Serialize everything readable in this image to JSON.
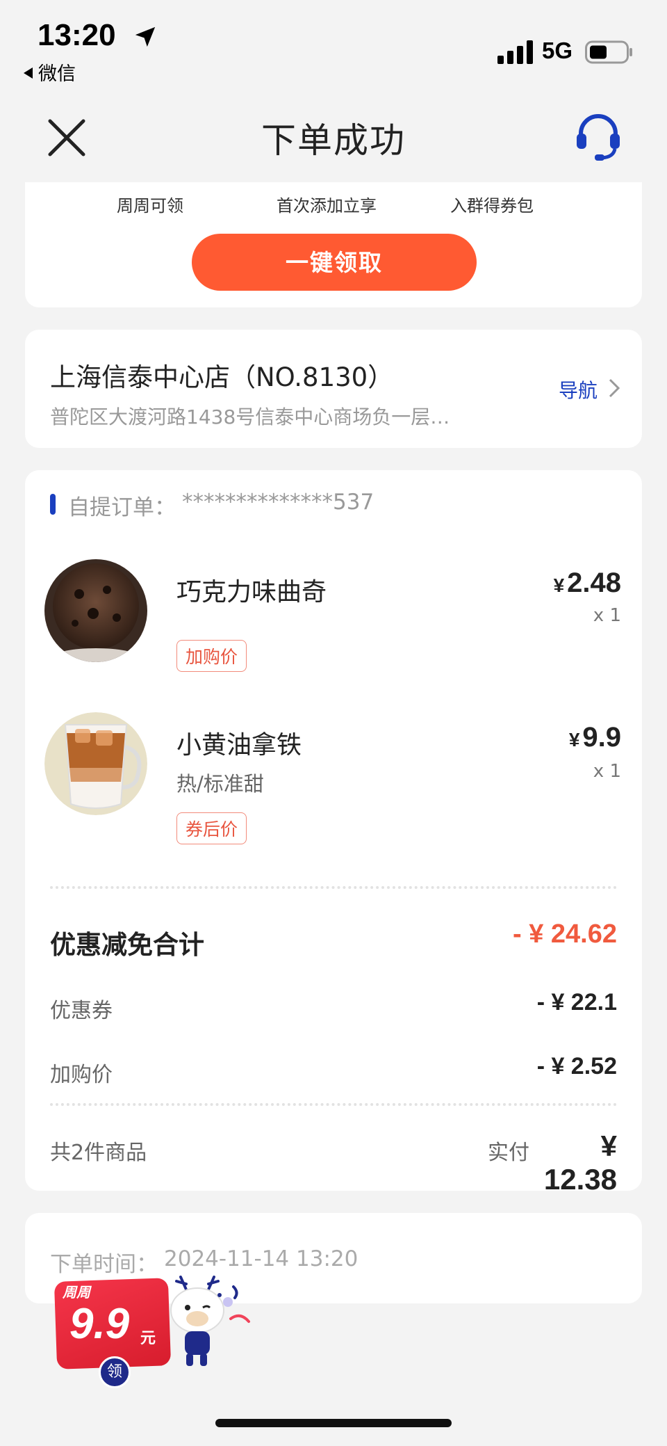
{
  "status_bar": {
    "time": "13:20",
    "back_app": "微信",
    "network": "5G"
  },
  "nav": {
    "title": "下单成功"
  },
  "coupon_card": {
    "perks": [
      "周周可领",
      "首次添加立享",
      "入群得券包"
    ],
    "claim_button": "一键领取"
  },
  "store": {
    "name": "上海信泰中心店（NO.8130）",
    "address": "普陀区大渡河路1438号信泰中心商场负一层…",
    "nav_label": "导航"
  },
  "order": {
    "label": "自提订单：",
    "number": "**************537",
    "items": [
      {
        "name": "巧克力味曲奇",
        "spec": "",
        "price": "2.48",
        "qty": "x 1",
        "tag": "加购价"
      },
      {
        "name": "小黄油拿铁",
        "spec": "热/标准甜",
        "price": "9.9",
        "qty": "x 1",
        "tag": "券后价"
      }
    ],
    "currency": "¥",
    "discount_title": "优惠减免合计",
    "discount_total": "- ¥ 24.62",
    "discount_rows": [
      {
        "label": "优惠券",
        "amount": "- ¥ 22.1"
      },
      {
        "label": "加购价",
        "amount": "- ¥ 2.52"
      }
    ],
    "item_count": "共2件商品",
    "paid_label": "实付",
    "paid_amount": "¥ 12.38"
  },
  "order_time": {
    "label": "下单时间：",
    "value": "2024-11-14 13:20"
  },
  "promo": {
    "top": "周周",
    "price": "9.9",
    "unit": "元",
    "claim": "领"
  },
  "colors": {
    "accent": "#ff5a32",
    "brand_blue": "#1a3fbf",
    "discount_red": "#f05a3e"
  }
}
